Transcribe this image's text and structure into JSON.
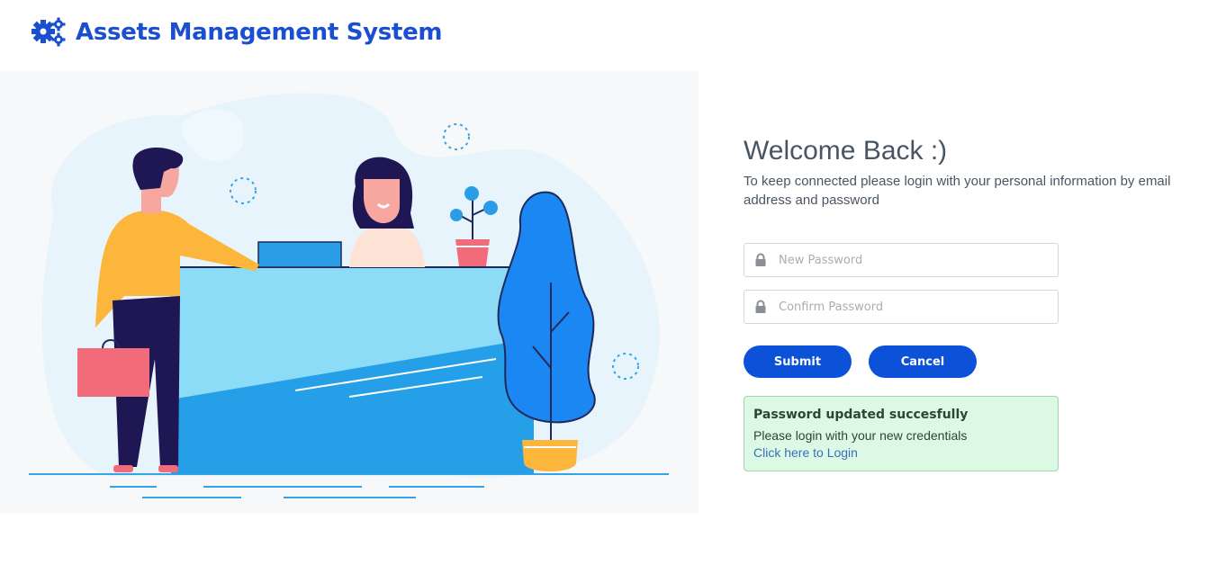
{
  "header": {
    "logo_icon": "gears-icon",
    "title": "Assets Management System"
  },
  "illustration": {
    "description_icon": "reception-desk-illustration"
  },
  "login": {
    "welcome_title": "Welcome Back :)",
    "welcome_subtitle": "To keep connected please login with your personal information by email address and password",
    "new_password_placeholder": "New Password",
    "confirm_password_placeholder": "Confirm Password",
    "submit_label": "Submit",
    "cancel_label": "Cancel"
  },
  "alert": {
    "title": "Password updated succesfully",
    "message": "Please login with your new credentials",
    "link_text": "Click here to Login"
  },
  "colors": {
    "brand": "#1a4fd0",
    "button": "#0b52d9",
    "alert_bg": "#dbf9e5"
  }
}
